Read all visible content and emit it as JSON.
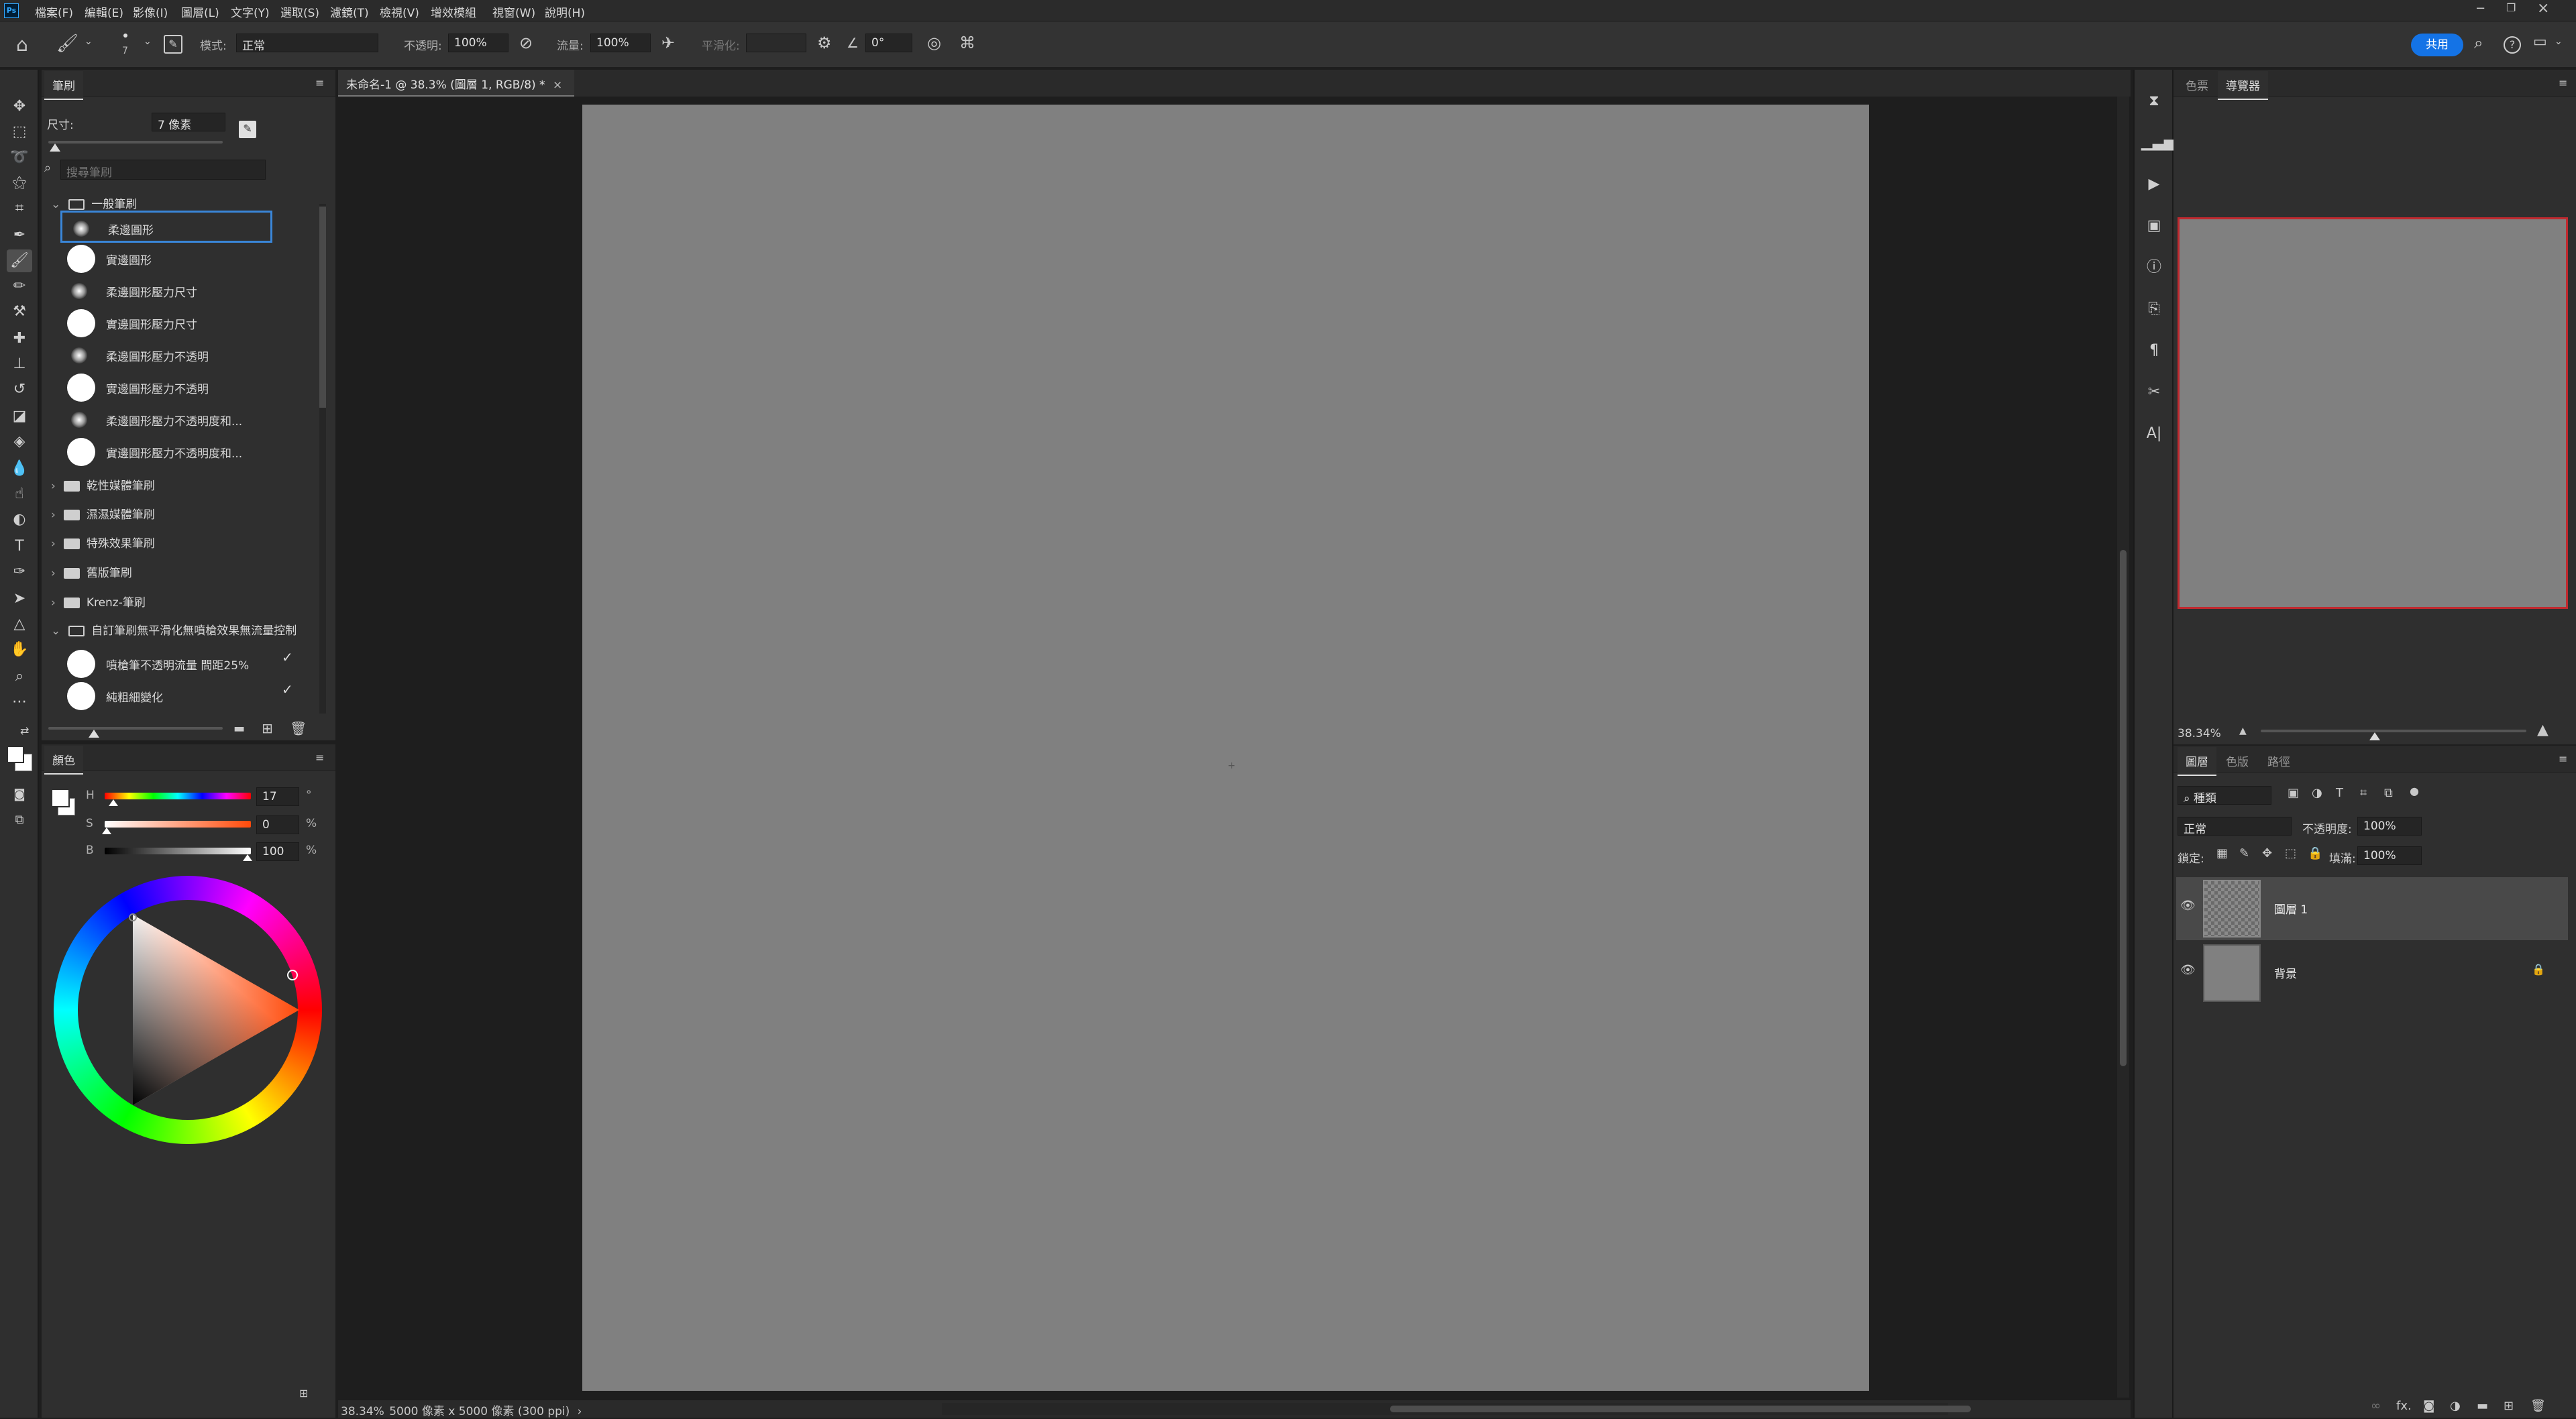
{
  "menu": {
    "app_icon": "Ps",
    "items": [
      "檔案(F)",
      "編輯(E)",
      "影像(I)",
      "圖層(L)",
      "文字(Y)",
      "選取(S)",
      "濾鏡(T)",
      "檢視(V)",
      "增效模組",
      "視窗(W)",
      "說明(H)"
    ]
  },
  "options": {
    "brush_size": "7",
    "mode_label": "模式:",
    "mode_value": "正常",
    "opacity_label": "不透明:",
    "opacity_value": "100%",
    "flow_label": "流量:",
    "flow_value": "100%",
    "smoothing_label": "平滑化:",
    "smoothing_value": "",
    "angle_value": "0°",
    "share_label": "共用"
  },
  "brush_panel": {
    "tab": "筆刷",
    "size_label": "尺寸:",
    "size_value": "7 像素",
    "search_placeholder": "搜尋筆刷",
    "general_group": "一般筆刷",
    "brushes": [
      {
        "name": "柔邊圓形",
        "tip": "soft"
      },
      {
        "name": "實邊圓形",
        "tip": "hard"
      },
      {
        "name": "柔邊圓形壓力尺寸",
        "tip": "soft"
      },
      {
        "name": "實邊圓形壓力尺寸",
        "tip": "hard"
      },
      {
        "name": "柔邊圓形壓力不透明",
        "tip": "soft"
      },
      {
        "name": "實邊圓形壓力不透明",
        "tip": "hard"
      },
      {
        "name": "柔邊圓形壓力不透明度和...",
        "tip": "soft"
      },
      {
        "name": "實邊圓形壓力不透明度和...",
        "tip": "hard"
      }
    ],
    "groups": [
      "乾性媒體筆刷",
      "濕濕媒體筆刷",
      "特殊效果筆刷",
      "舊版筆刷",
      "Krenz-筆刷"
    ],
    "custom_group": "自訂筆刷無平滑化無噴槍效果無流量控制",
    "custom_brushes": [
      "噴槍筆不透明流量 間距25%",
      "純粗細變化"
    ]
  },
  "color_panel": {
    "tab": "顏色",
    "h_label": "H",
    "h_value": "17",
    "h_unit": "°",
    "s_label": "S",
    "s_value": "0",
    "s_unit": "%",
    "b_label": "B",
    "b_value": "100",
    "b_unit": "%"
  },
  "document": {
    "tab_title": "未命名-1 @ 38.3% (圖層 1, RGB/8) *",
    "zoom": "38.34%",
    "status": "5000 像素 x 5000 像素 (300 ppi)"
  },
  "navigator": {
    "tabs": [
      "色票",
      "導覽器"
    ],
    "zoom": "38.34%"
  },
  "layers_panel": {
    "tabs": [
      "圖層",
      "色版",
      "路徑"
    ],
    "filter_value": "種類",
    "blend_mode": "正常",
    "opacity_label": "不透明度:",
    "opacity_value": "100%",
    "lock_label": "鎖定:",
    "fill_label": "填滿:",
    "fill_value": "100%",
    "layers": [
      {
        "name": "圖層 1",
        "kind": "transparent"
      },
      {
        "name": "背景",
        "kind": "gray"
      }
    ]
  },
  "colors": {
    "accent": "#1473e6",
    "canvas": "#808080",
    "panel": "#2f2f2f",
    "selection": "#3a86d8",
    "nav_border": "#c0292f"
  }
}
